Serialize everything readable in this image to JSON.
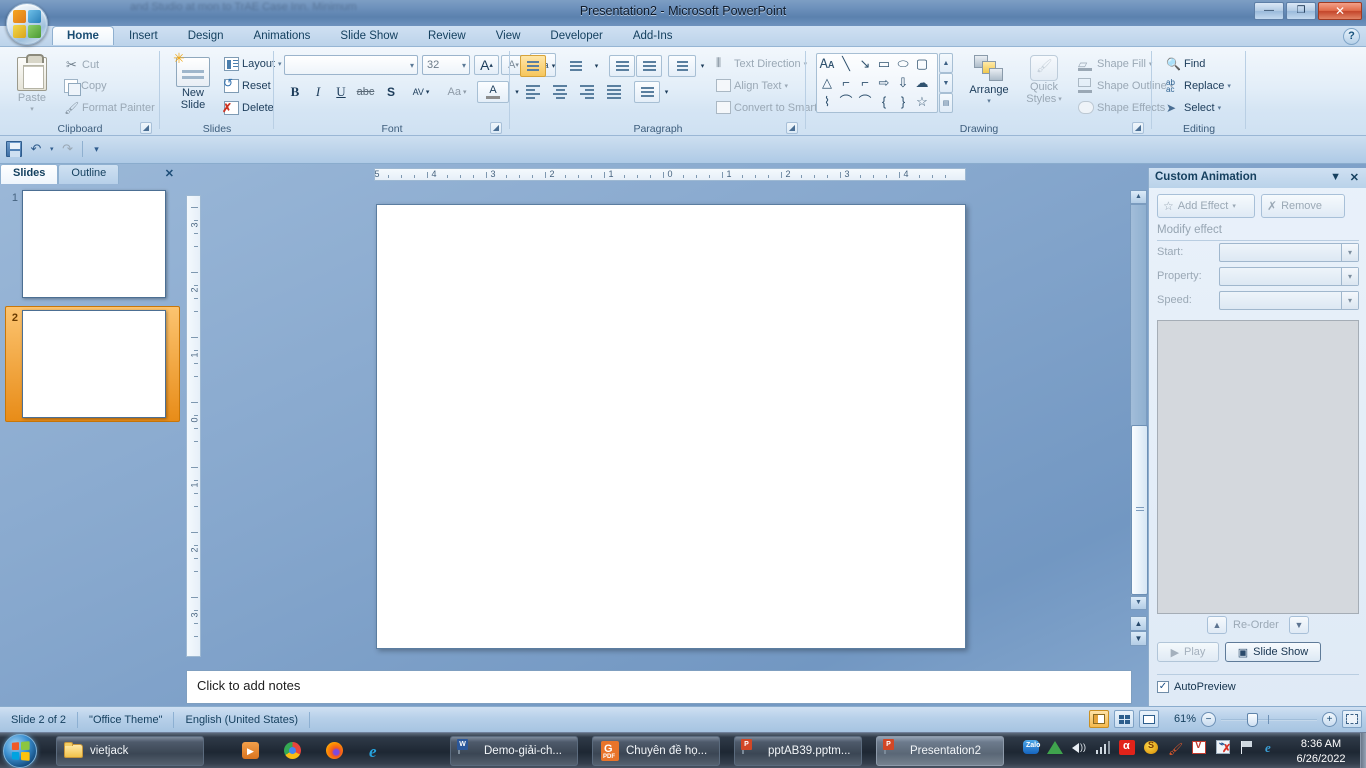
{
  "window": {
    "title": "Presentation2 - Microsoft PowerPoint",
    "ghost_text": "and Studio at mon to TrAE Case Inn.  Minimum",
    "minimize": "—",
    "maximize": "❐",
    "close": "✕",
    "help": "?"
  },
  "ribbon": {
    "office_button": "office-orb",
    "tabs": [
      {
        "label": "Home",
        "active": true
      },
      {
        "label": "Insert",
        "active": false
      },
      {
        "label": "Design",
        "active": false
      },
      {
        "label": "Animations",
        "active": false
      },
      {
        "label": "Slide Show",
        "active": false
      },
      {
        "label": "Review",
        "active": false
      },
      {
        "label": "View",
        "active": false
      },
      {
        "label": "Developer",
        "active": false
      },
      {
        "label": "Add-Ins",
        "active": false
      }
    ],
    "clipboard": {
      "title": "Clipboard",
      "paste": "Paste",
      "cut": "Cut",
      "copy": "Copy",
      "format_painter": "Format Painter",
      "launcher": "◢"
    },
    "slides": {
      "title": "Slides",
      "new_slide": "New",
      "new_slide2": "Slide",
      "layout": "Layout",
      "reset": "Reset",
      "delete": "Delete"
    },
    "font": {
      "title": "Font",
      "font_name": "",
      "font_name_placeholder": "",
      "font_size": "32",
      "grow": "A",
      "shrink": "A",
      "clear_formatting": "Aa",
      "bold": "B",
      "italic": "I",
      "underline": "U",
      "strikethrough": "abc",
      "shadow": "S",
      "spacing": "AV",
      "change_case": "Aa",
      "font_color": "A",
      "launcher": "◢"
    },
    "paragraph": {
      "title": "Paragraph",
      "text_direction": "Text Direction",
      "align_text": "Align Text",
      "convert_smartart": "Convert to SmartArt",
      "launcher": "◢"
    },
    "drawing": {
      "title": "Drawing",
      "arrange": "Arrange",
      "quick_styles1": "Quick",
      "quick_styles2": "Styles",
      "shape_fill": "Shape Fill",
      "shape_outline": "Shape Outline",
      "shape_effects": "Shape Effects",
      "launcher": "◢",
      "shapes_row1": [
        "text-box",
        "line",
        "arrow",
        "rectangle",
        "oval",
        "rounded-rectangle"
      ],
      "shapes_row2": [
        "triangle",
        "elbow-connector",
        "elbow-arrow",
        "right-arrow",
        "down-arrow",
        "cloud"
      ],
      "shapes_row3": [
        "freeform",
        "curve",
        "arc",
        "left-brace",
        "right-brace",
        "star"
      ]
    },
    "editing": {
      "title": "Editing",
      "find": "Find",
      "replace": "Replace",
      "select": "Select"
    }
  },
  "qat": {
    "save": "save-icon",
    "undo": "↶",
    "undo_arrow": "▾",
    "redo": "↷",
    "customize": "▾"
  },
  "slides_panel": {
    "tab_slides": "Slides",
    "tab_outline": "Outline",
    "close": "✕",
    "thumbnails": [
      {
        "number": "1",
        "selected": false
      },
      {
        "number": "2",
        "selected": true
      }
    ]
  },
  "rulers": {
    "horizontal_numbers": [
      "5",
      "4",
      "3",
      "2",
      "1",
      "0",
      "1",
      "2",
      "3",
      "4",
      "5"
    ],
    "vertical_numbers": [
      "3",
      "2",
      "1",
      "0",
      "1",
      "2",
      "3"
    ]
  },
  "notes": {
    "placeholder": "Click to add notes"
  },
  "scrollbar": {
    "up": "▲",
    "down": "▼",
    "prev_slide": "▲",
    "next_slide": "▼"
  },
  "custom_animation": {
    "title": "Custom Animation",
    "dropdown": "▼",
    "close": "✕",
    "add_effect": "Add Effect",
    "add_effect_arrow": "▾",
    "remove": "Remove",
    "modify_effect": "Modify effect",
    "start_label": "Start:",
    "start_value": "",
    "property_label": "Property:",
    "property_value": "",
    "speed_label": "Speed:",
    "speed_value": "",
    "reorder": "Re-Order",
    "reorder_up": "▲",
    "reorder_down": "▼",
    "play": "Play",
    "play_icon": "▶",
    "slide_show": "Slide Show",
    "autopreview": "AutoPreview",
    "autopreview_checked": "✓"
  },
  "statusbar": {
    "slide_count": "Slide 2 of 2",
    "theme": "\"Office Theme\"",
    "language": "English (United States)",
    "zoom_level": "61%",
    "zoom_out": "−",
    "zoom_in": "+",
    "view_normal": "normal-view-icon",
    "view_sorter": "slide-sorter-icon",
    "view_show": "slide-show-icon",
    "fit_window": "fit-to-window-icon"
  },
  "taskbar": {
    "start": "start-orb",
    "explorer": "vietjack",
    "quick_launch": [
      "media-player-icon",
      "chrome-icon",
      "firefox-icon",
      "internet-explorer-icon"
    ],
    "buttons": [
      {
        "label": "Demo-giải-ch...",
        "icon": "word-icon",
        "badge": "W",
        "badge_color": "#2b579a",
        "active": false
      },
      {
        "label": "Chuyên đề họ...",
        "icon": "pdf-icon",
        "badge": "",
        "badge_color": "#e8742a",
        "active": false
      },
      {
        "label": "pptAB39.pptm...",
        "icon": "powerpoint-icon",
        "badge": "P",
        "badge_color": "#d24726",
        "active": false
      },
      {
        "label": "Presentation2",
        "icon": "powerpoint-icon",
        "badge": "P",
        "badge_color": "#d24726",
        "active": true
      }
    ],
    "tray": [
      "zalo-icon",
      "google-drive-icon",
      "volume-icon",
      "network-icon",
      "avira-icon",
      "unikey-icon",
      "utility-icon",
      "vietkey-icon",
      "bluetooth-icon",
      "flag-icon",
      "ie-icon"
    ],
    "time": "8:36 AM",
    "date": "6/26/2022"
  }
}
